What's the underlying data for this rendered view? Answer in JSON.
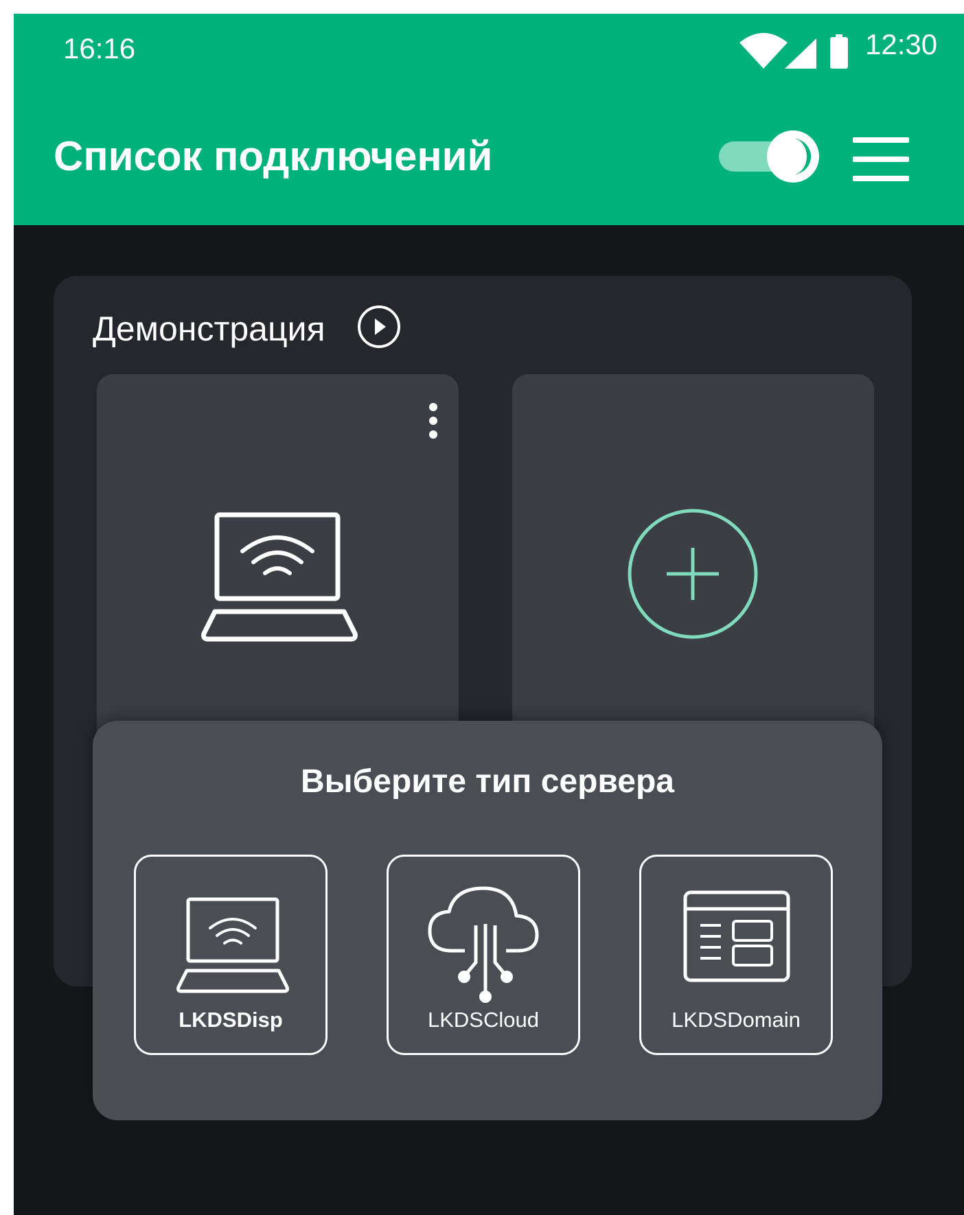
{
  "status_bar": {
    "time_left": "16:16",
    "time_right": "12:30",
    "icons": [
      "wifi-icon",
      "signal-icon",
      "battery-icon"
    ]
  },
  "app_bar": {
    "title": "Список подключений",
    "theme_toggle_icon": "dark-mode-icon",
    "menu_icon": "hamburger-menu-icon"
  },
  "demo_section": {
    "title": "Демонстрация",
    "play_icon": "play-circle-icon",
    "tiles": [
      {
        "icon": "laptop-wifi-icon",
        "menu_icon": "more-vert-icon"
      },
      {
        "icon": "add-circle-icon"
      }
    ]
  },
  "server_sheet": {
    "title": "Выберите тип сервера",
    "options": [
      {
        "label": "LKDSDisp",
        "icon": "laptop-wifi-icon"
      },
      {
        "label": "LKDSCloud",
        "icon": "cloud-network-icon"
      },
      {
        "label": "LKDSDomain",
        "icon": "domain-window-icon"
      }
    ]
  },
  "colors": {
    "app_bar": "#00b27a",
    "background": "#16171b",
    "panel": "#25272d",
    "tile": "#3b3e45",
    "sheet": "#4a4d54",
    "accent_light": "#7fdbbb"
  }
}
